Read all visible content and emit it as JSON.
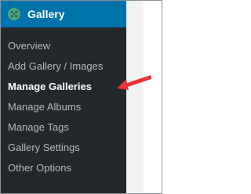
{
  "menu": {
    "icon": "nextgen-gallery-icon",
    "title": "Gallery",
    "accent_color": "#0073aa",
    "sidebar_color": "#23282d"
  },
  "submenu": {
    "items": [
      {
        "label": "Overview"
      },
      {
        "label": "Add Gallery / Images"
      },
      {
        "label": "Manage Galleries",
        "current": true
      },
      {
        "label": "Manage Albums"
      },
      {
        "label": "Manage Tags"
      },
      {
        "label": "Gallery Settings"
      },
      {
        "label": "Other Options"
      }
    ]
  },
  "annotation": {
    "icon": "red-arrow-icon",
    "color": "#e8323c"
  }
}
